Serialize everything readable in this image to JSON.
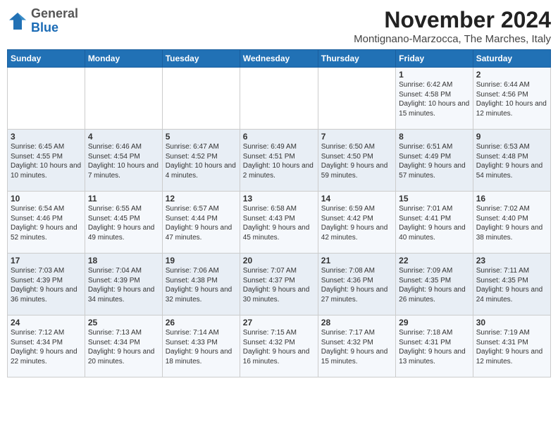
{
  "logo": {
    "general": "General",
    "blue": "Blue"
  },
  "title": "November 2024",
  "subtitle": "Montignano-Marzocca, The Marches, Italy",
  "weekdays": [
    "Sunday",
    "Monday",
    "Tuesday",
    "Wednesday",
    "Thursday",
    "Friday",
    "Saturday"
  ],
  "weeks": [
    [
      {
        "day": "",
        "info": ""
      },
      {
        "day": "",
        "info": ""
      },
      {
        "day": "",
        "info": ""
      },
      {
        "day": "",
        "info": ""
      },
      {
        "day": "",
        "info": ""
      },
      {
        "day": "1",
        "info": "Sunrise: 6:42 AM\nSunset: 4:58 PM\nDaylight: 10 hours and 15 minutes."
      },
      {
        "day": "2",
        "info": "Sunrise: 6:44 AM\nSunset: 4:56 PM\nDaylight: 10 hours and 12 minutes."
      }
    ],
    [
      {
        "day": "3",
        "info": "Sunrise: 6:45 AM\nSunset: 4:55 PM\nDaylight: 10 hours and 10 minutes."
      },
      {
        "day": "4",
        "info": "Sunrise: 6:46 AM\nSunset: 4:54 PM\nDaylight: 10 hours and 7 minutes."
      },
      {
        "day": "5",
        "info": "Sunrise: 6:47 AM\nSunset: 4:52 PM\nDaylight: 10 hours and 4 minutes."
      },
      {
        "day": "6",
        "info": "Sunrise: 6:49 AM\nSunset: 4:51 PM\nDaylight: 10 hours and 2 minutes."
      },
      {
        "day": "7",
        "info": "Sunrise: 6:50 AM\nSunset: 4:50 PM\nDaylight: 9 hours and 59 minutes."
      },
      {
        "day": "8",
        "info": "Sunrise: 6:51 AM\nSunset: 4:49 PM\nDaylight: 9 hours and 57 minutes."
      },
      {
        "day": "9",
        "info": "Sunrise: 6:53 AM\nSunset: 4:48 PM\nDaylight: 9 hours and 54 minutes."
      }
    ],
    [
      {
        "day": "10",
        "info": "Sunrise: 6:54 AM\nSunset: 4:46 PM\nDaylight: 9 hours and 52 minutes."
      },
      {
        "day": "11",
        "info": "Sunrise: 6:55 AM\nSunset: 4:45 PM\nDaylight: 9 hours and 49 minutes."
      },
      {
        "day": "12",
        "info": "Sunrise: 6:57 AM\nSunset: 4:44 PM\nDaylight: 9 hours and 47 minutes."
      },
      {
        "day": "13",
        "info": "Sunrise: 6:58 AM\nSunset: 4:43 PM\nDaylight: 9 hours and 45 minutes."
      },
      {
        "day": "14",
        "info": "Sunrise: 6:59 AM\nSunset: 4:42 PM\nDaylight: 9 hours and 42 minutes."
      },
      {
        "day": "15",
        "info": "Sunrise: 7:01 AM\nSunset: 4:41 PM\nDaylight: 9 hours and 40 minutes."
      },
      {
        "day": "16",
        "info": "Sunrise: 7:02 AM\nSunset: 4:40 PM\nDaylight: 9 hours and 38 minutes."
      }
    ],
    [
      {
        "day": "17",
        "info": "Sunrise: 7:03 AM\nSunset: 4:39 PM\nDaylight: 9 hours and 36 minutes."
      },
      {
        "day": "18",
        "info": "Sunrise: 7:04 AM\nSunset: 4:39 PM\nDaylight: 9 hours and 34 minutes."
      },
      {
        "day": "19",
        "info": "Sunrise: 7:06 AM\nSunset: 4:38 PM\nDaylight: 9 hours and 32 minutes."
      },
      {
        "day": "20",
        "info": "Sunrise: 7:07 AM\nSunset: 4:37 PM\nDaylight: 9 hours and 30 minutes."
      },
      {
        "day": "21",
        "info": "Sunrise: 7:08 AM\nSunset: 4:36 PM\nDaylight: 9 hours and 27 minutes."
      },
      {
        "day": "22",
        "info": "Sunrise: 7:09 AM\nSunset: 4:35 PM\nDaylight: 9 hours and 26 minutes."
      },
      {
        "day": "23",
        "info": "Sunrise: 7:11 AM\nSunset: 4:35 PM\nDaylight: 9 hours and 24 minutes."
      }
    ],
    [
      {
        "day": "24",
        "info": "Sunrise: 7:12 AM\nSunset: 4:34 PM\nDaylight: 9 hours and 22 minutes."
      },
      {
        "day": "25",
        "info": "Sunrise: 7:13 AM\nSunset: 4:34 PM\nDaylight: 9 hours and 20 minutes."
      },
      {
        "day": "26",
        "info": "Sunrise: 7:14 AM\nSunset: 4:33 PM\nDaylight: 9 hours and 18 minutes."
      },
      {
        "day": "27",
        "info": "Sunrise: 7:15 AM\nSunset: 4:32 PM\nDaylight: 9 hours and 16 minutes."
      },
      {
        "day": "28",
        "info": "Sunrise: 7:17 AM\nSunset: 4:32 PM\nDaylight: 9 hours and 15 minutes."
      },
      {
        "day": "29",
        "info": "Sunrise: 7:18 AM\nSunset: 4:31 PM\nDaylight: 9 hours and 13 minutes."
      },
      {
        "day": "30",
        "info": "Sunrise: 7:19 AM\nSunset: 4:31 PM\nDaylight: 9 hours and 12 minutes."
      }
    ]
  ]
}
